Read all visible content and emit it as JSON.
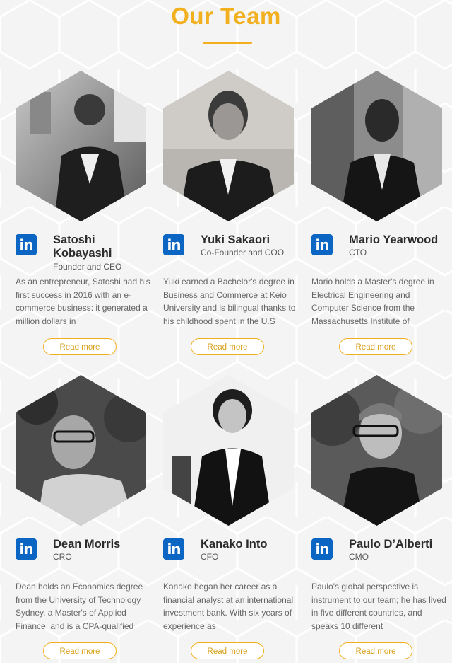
{
  "page": {
    "title": "Our Team"
  },
  "icons": {
    "linkedin": "linkedin-icon",
    "linkedin_glyph": "in"
  },
  "colors": {
    "accent": "#f2b01e",
    "linkedin": "#0a66c2"
  },
  "team": [
    {
      "name": "Satoshi Kobayashi",
      "role": "Founder and CEO",
      "bio": "As an entrepreneur, Satoshi had his first success in 2016 with an e-commerce business: it generated a million dollars in",
      "cta": "Read more"
    },
    {
      "name": "Yuki Sakaori",
      "role": "Co-Founder and COO",
      "bio": "Yuki earned a Bachelor's degree in Business and Commerce at Keio University and is bilingual thanks to his childhood spent in the U.S",
      "cta": "Read more"
    },
    {
      "name": "Mario Yearwood",
      "role": "CTO",
      "bio": "Mario holds a Master's degree in Electrical Engineering and Computer Science from the Massachusetts Institute of",
      "cta": "Read more"
    },
    {
      "name": "Dean Morris",
      "role": "CRO",
      "bio": "Dean holds an Economics degree from the University of Technology Sydney, a Master's of Applied Finance, and is a CPA-qualified",
      "cta": "Read more"
    },
    {
      "name": "Kanako Into",
      "role": "CFO",
      "bio": "Kanako began her career as a financial analyst at an international investment bank. With six years of experience as",
      "cta": "Read more"
    },
    {
      "name": "Paulo D’Alberti",
      "role": "CMO",
      "bio": "Paulo's global perspective is instrument to our team; he has lived in five different countries, and speaks 10 different",
      "cta": "Read more"
    }
  ]
}
